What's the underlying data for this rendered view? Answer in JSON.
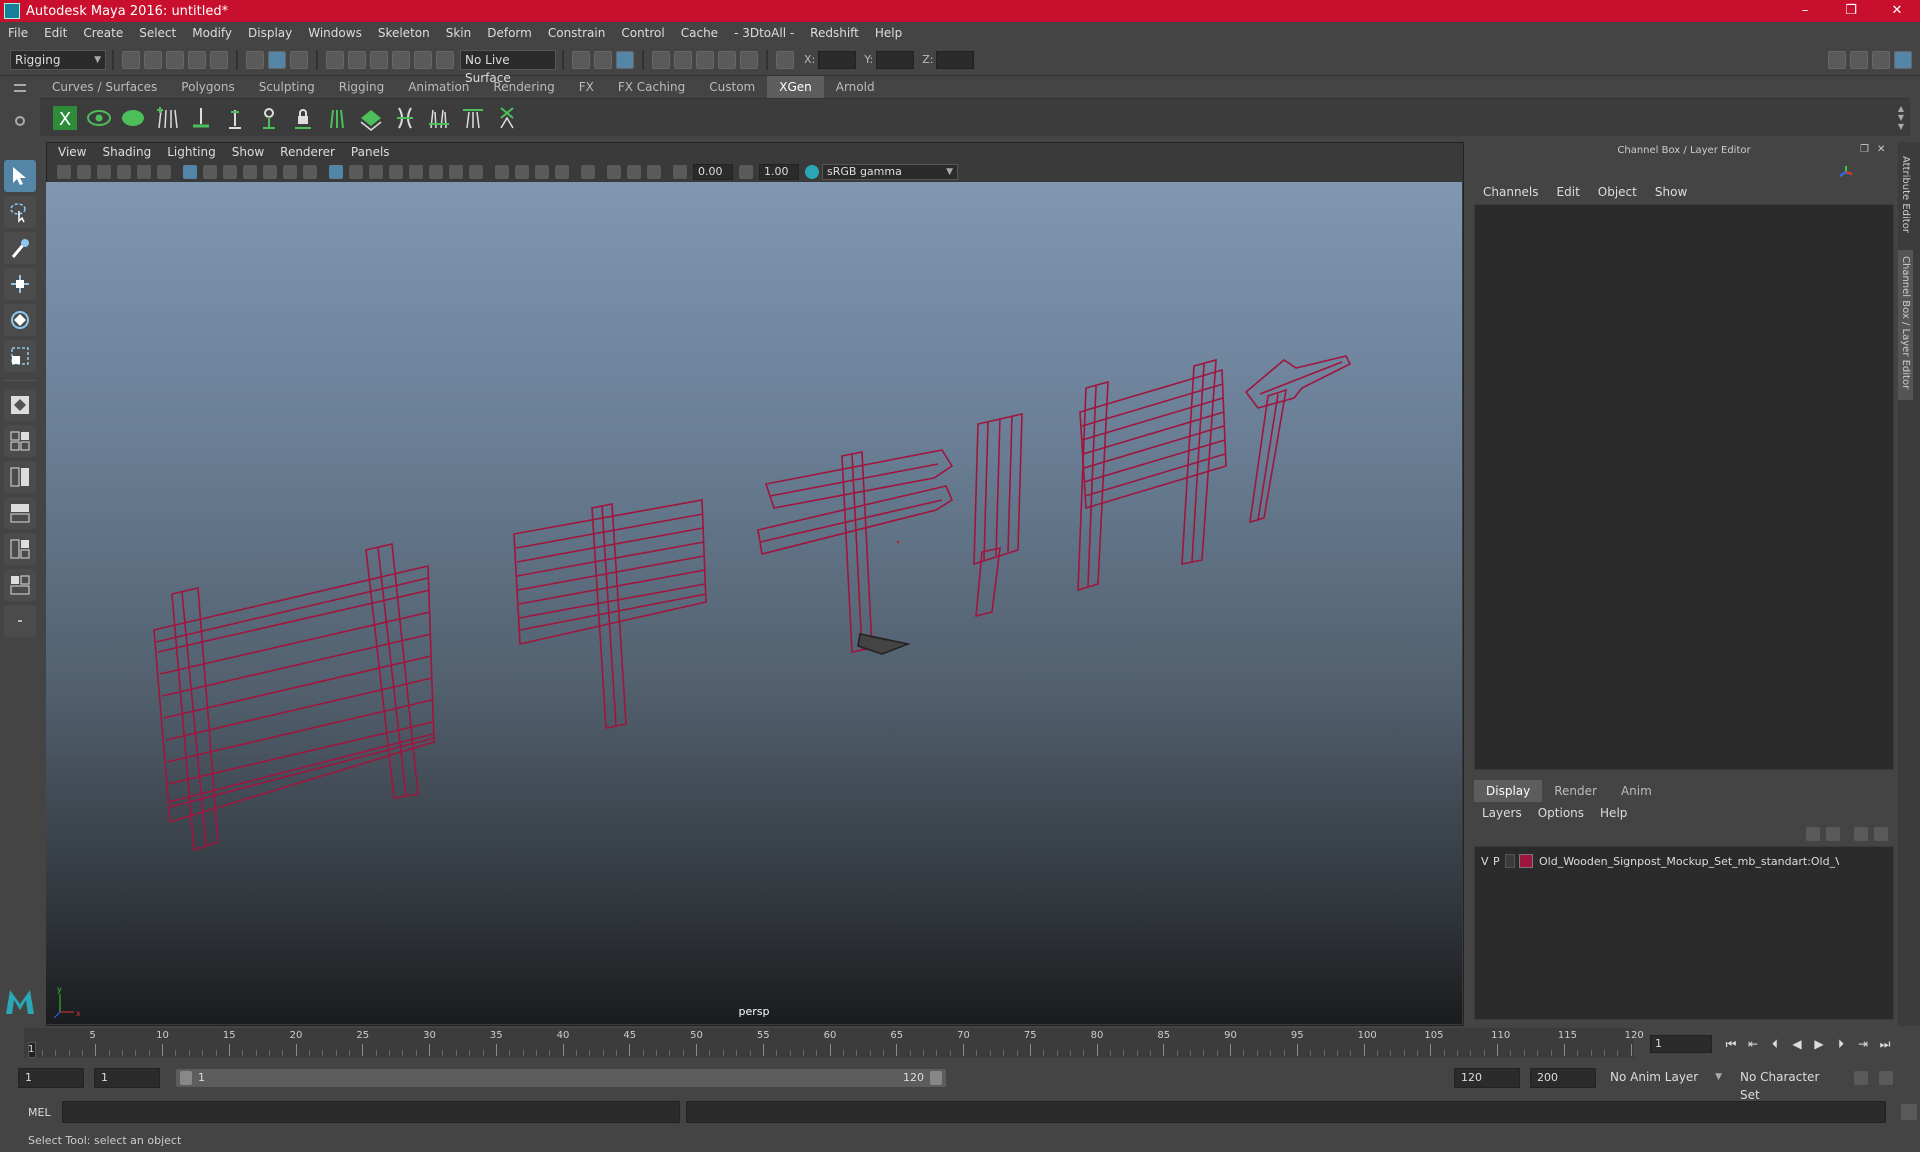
{
  "titlebar": {
    "title": "Autodesk Maya 2016: untitled*",
    "min": "–",
    "max": "❐",
    "close": "✕"
  },
  "menubar": [
    "File",
    "Edit",
    "Create",
    "Select",
    "Modify",
    "Display",
    "Windows",
    "Skeleton",
    "Skin",
    "Deform",
    "Constrain",
    "Control",
    "Cache",
    "- 3DtoAll -",
    "Redshift",
    "Help"
  ],
  "statusline": {
    "mode": "Rigging",
    "live_surface": "No Live Surface",
    "x_label": "X:",
    "y_label": "Y:",
    "z_label": "Z:"
  },
  "shelf": {
    "tabs": [
      "Curves / Surfaces",
      "Polygons",
      "Sculpting",
      "Rigging",
      "Animation",
      "Rendering",
      "FX",
      "FX Caching",
      "Custom",
      "XGen",
      "Arnold"
    ],
    "active_tab": "XGen"
  },
  "viewport": {
    "menus": [
      "View",
      "Shading",
      "Lighting",
      "Show",
      "Renderer",
      "Panels"
    ],
    "exposure": "0.00",
    "gamma": "1.00",
    "color_space": "sRGB gamma",
    "camera": "persp",
    "wire_color": "#a0153e"
  },
  "channel_box": {
    "title": "Channel Box / Layer Editor",
    "menus": [
      "Channels",
      "Edit",
      "Object",
      "Show"
    ]
  },
  "layer_editor": {
    "tabs": [
      "Display",
      "Render",
      "Anim"
    ],
    "active_tab": "Display",
    "menus": [
      "Layers",
      "Options",
      "Help"
    ],
    "layers": [
      {
        "v": "V",
        "p": "P",
        "name": "Old_Wooden_Signpost_Mockup_Set_mb_standart:Old_V",
        "color": "#a0153e"
      }
    ]
  },
  "side_tabs": [
    "Attribute Editor",
    "Channel Box / Layer Editor"
  ],
  "timeline": {
    "ticks": [
      "5",
      "10",
      "15",
      "20",
      "25",
      "30",
      "35",
      "40",
      "45",
      "50",
      "55",
      "60",
      "65",
      "70",
      "75",
      "80",
      "85",
      "90",
      "95",
      "100",
      "105",
      "110",
      "115",
      "120"
    ],
    "start_tick": "1",
    "current_frame": "1",
    "range_start": "1",
    "range_start_inner": "1",
    "slider_start": "1",
    "slider_end": "120",
    "range_end": "120",
    "anim_end": "200",
    "anim_layer": "No Anim Layer",
    "character_set": "No Character Set"
  },
  "cmdline": {
    "label": "MEL"
  },
  "status": {
    "message": "Select Tool: select an object"
  }
}
